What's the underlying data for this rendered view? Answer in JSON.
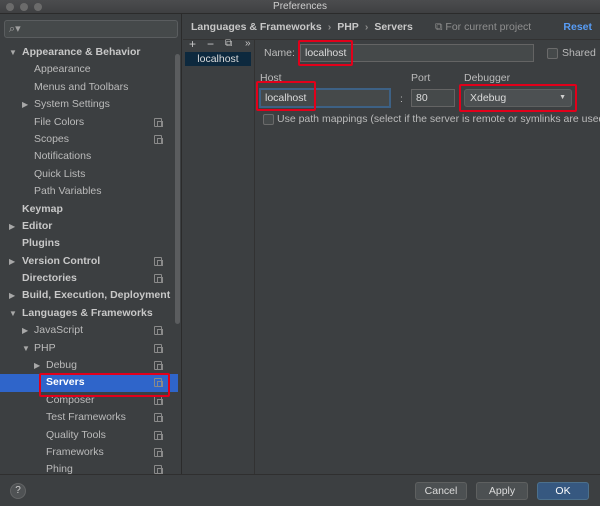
{
  "window": {
    "title": "Preferences"
  },
  "search": {
    "placeholder": ""
  },
  "sidebar": {
    "items": [
      {
        "label": "Appearance & Behavior",
        "level": 0,
        "bold": true,
        "arrow": "▼",
        "copy": false
      },
      {
        "label": "Appearance",
        "level": 1,
        "bold": false,
        "arrow": "",
        "copy": false
      },
      {
        "label": "Menus and Toolbars",
        "level": 1,
        "bold": false,
        "arrow": "",
        "copy": false
      },
      {
        "label": "System Settings",
        "level": 1,
        "bold": false,
        "arrow": "▶",
        "copy": false
      },
      {
        "label": "File Colors",
        "level": 1,
        "bold": false,
        "arrow": "",
        "copy": true
      },
      {
        "label": "Scopes",
        "level": 1,
        "bold": false,
        "arrow": "",
        "copy": true
      },
      {
        "label": "Notifications",
        "level": 1,
        "bold": false,
        "arrow": "",
        "copy": false
      },
      {
        "label": "Quick Lists",
        "level": 1,
        "bold": false,
        "arrow": "",
        "copy": false
      },
      {
        "label": "Path Variables",
        "level": 1,
        "bold": false,
        "arrow": "",
        "copy": false
      },
      {
        "label": "Keymap",
        "level": 0,
        "bold": true,
        "arrow": "",
        "copy": false
      },
      {
        "label": "Editor",
        "level": 0,
        "bold": true,
        "arrow": "▶",
        "copy": false
      },
      {
        "label": "Plugins",
        "level": 0,
        "bold": true,
        "arrow": "",
        "copy": false
      },
      {
        "label": "Version Control",
        "level": 0,
        "bold": true,
        "arrow": "▶",
        "copy": true
      },
      {
        "label": "Directories",
        "level": 0,
        "bold": true,
        "arrow": "",
        "copy": true
      },
      {
        "label": "Build, Execution, Deployment",
        "level": 0,
        "bold": true,
        "arrow": "▶",
        "copy": false
      },
      {
        "label": "Languages & Frameworks",
        "level": 0,
        "bold": true,
        "arrow": "▼",
        "copy": false
      },
      {
        "label": "JavaScript",
        "level": 1,
        "bold": false,
        "arrow": "▶",
        "copy": true
      },
      {
        "label": "PHP",
        "level": 1,
        "bold": false,
        "arrow": "▼",
        "copy": true
      },
      {
        "label": "Debug",
        "level": 2,
        "bold": false,
        "arrow": "▶",
        "copy": true
      },
      {
        "label": "Servers",
        "level": 2,
        "bold": true,
        "arrow": "",
        "copy": true,
        "selected": true
      },
      {
        "label": "Composer",
        "level": 2,
        "bold": false,
        "arrow": "",
        "copy": true
      },
      {
        "label": "Test Frameworks",
        "level": 2,
        "bold": false,
        "arrow": "",
        "copy": true
      },
      {
        "label": "Quality Tools",
        "level": 2,
        "bold": false,
        "arrow": "",
        "copy": true
      },
      {
        "label": "Frameworks",
        "level": 2,
        "bold": false,
        "arrow": "",
        "copy": true
      },
      {
        "label": "Phing",
        "level": 2,
        "bold": false,
        "arrow": "",
        "copy": true
      }
    ]
  },
  "breadcrumb": {
    "parts": [
      "Languages & Frameworks",
      "PHP",
      "Servers"
    ],
    "separator": "›",
    "scope": "For current project",
    "reset": "Reset"
  },
  "servers": {
    "toolbar": {
      "add": "+",
      "remove": "−",
      "copy": "⧉",
      "more": "»"
    },
    "list": [
      "localhost"
    ]
  },
  "form": {
    "name_label": "Name:",
    "name_value": "localhost",
    "shared_label": "Shared",
    "host_label": "Host",
    "host_value": "localhost",
    "port_label": "Port",
    "port_sep": ":",
    "port_value": "80",
    "debugger_label": "Debugger",
    "debugger_value": "Xdebug",
    "path_mappings_label": "Use path mappings (select if the server is remote or symlinks are used)"
  },
  "footer": {
    "help": "?",
    "cancel": "Cancel",
    "apply": "Apply",
    "ok": "OK"
  },
  "colors": {
    "accent": "#2f65ca",
    "highlight": "#e2001a",
    "link": "#589df6"
  }
}
